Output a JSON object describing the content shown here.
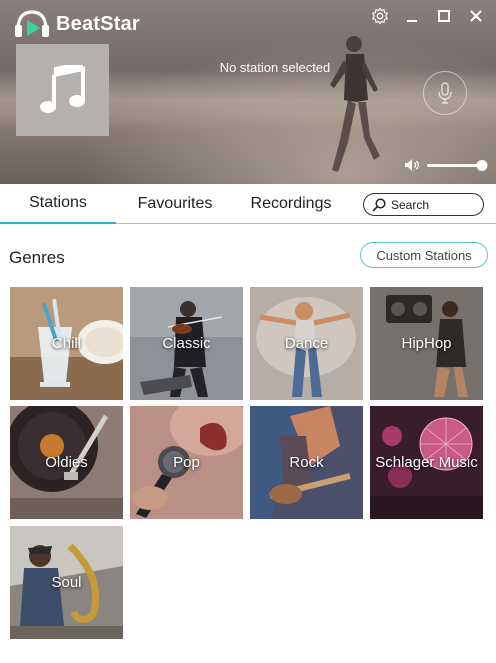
{
  "app": {
    "title": "BeatStar"
  },
  "player": {
    "station_status": "No station selected",
    "volume": 0.95
  },
  "tabs": [
    {
      "label": "Stations",
      "active": true
    },
    {
      "label": "Favourites",
      "active": false
    },
    {
      "label": "Recordings",
      "active": false
    }
  ],
  "search": {
    "placeholder": "Search"
  },
  "genres": {
    "title": "Genres",
    "custom_button": "Custom Stations",
    "items": [
      {
        "label": "Chill"
      },
      {
        "label": "Classic"
      },
      {
        "label": "Dance"
      },
      {
        "label": "HipHop"
      },
      {
        "label": "Oldies"
      },
      {
        "label": "Pop"
      },
      {
        "label": "Rock"
      },
      {
        "label": "Schlager Music"
      },
      {
        "label": "Soul"
      }
    ]
  },
  "colors": {
    "accent": "#2bb3c6",
    "logo_green": "#3ecf9f"
  }
}
